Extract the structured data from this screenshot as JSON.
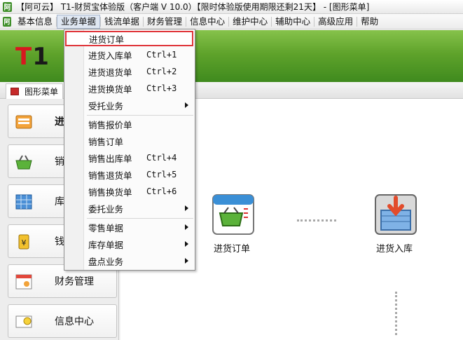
{
  "window": {
    "title": "【阿可云】 T1-财贸宝体验版（客户端 V 10.0）【限时体验版使用期限还剩21天】 - [图形菜单]"
  },
  "menubar": {
    "items": [
      "基本信息",
      "业务单据",
      "钱流单据",
      "财务管理",
      "信息中心",
      "维护中心",
      "辅助中心",
      "高级应用",
      "帮助"
    ]
  },
  "banner": {
    "logo": "T1"
  },
  "tab": {
    "label": "图形菜单"
  },
  "leftnav": {
    "items": [
      "进",
      "销",
      "库",
      "钱",
      "财务管理",
      "信息中心"
    ]
  },
  "workarea": {
    "flow": [
      {
        "label": "进货订单",
        "icon": "purchase-order-icon"
      },
      {
        "label": "进货入库",
        "icon": "stock-in-icon"
      }
    ]
  },
  "dropdown": {
    "items": [
      {
        "label": "进货订单",
        "shortcut": "",
        "submenu": false
      },
      {
        "label": "进货入库单",
        "shortcut": "Ctrl+1",
        "submenu": false
      },
      {
        "label": "进货退货单",
        "shortcut": "Ctrl+2",
        "submenu": false
      },
      {
        "label": "进货换货单",
        "shortcut": "Ctrl+3",
        "submenu": false
      },
      {
        "label": "受托业务",
        "shortcut": "",
        "submenu": true
      },
      {
        "label": "销售报价单",
        "shortcut": "",
        "submenu": false
      },
      {
        "label": "销售订单",
        "shortcut": "",
        "submenu": false
      },
      {
        "label": "销售出库单",
        "shortcut": "Ctrl+4",
        "submenu": false
      },
      {
        "label": "销售退货单",
        "shortcut": "Ctrl+5",
        "submenu": false
      },
      {
        "label": "销售换货单",
        "shortcut": "Ctrl+6",
        "submenu": false
      },
      {
        "label": "委托业务",
        "shortcut": "",
        "submenu": true
      },
      {
        "label": "零售单据",
        "shortcut": "",
        "submenu": true
      },
      {
        "label": "库存单据",
        "shortcut": "",
        "submenu": true
      },
      {
        "label": "盘点业务",
        "shortcut": "",
        "submenu": true
      }
    ]
  },
  "colors": {
    "banner_green": "#5fa32b",
    "highlight_border": "#e0353a",
    "accent_red": "#d7191f"
  }
}
